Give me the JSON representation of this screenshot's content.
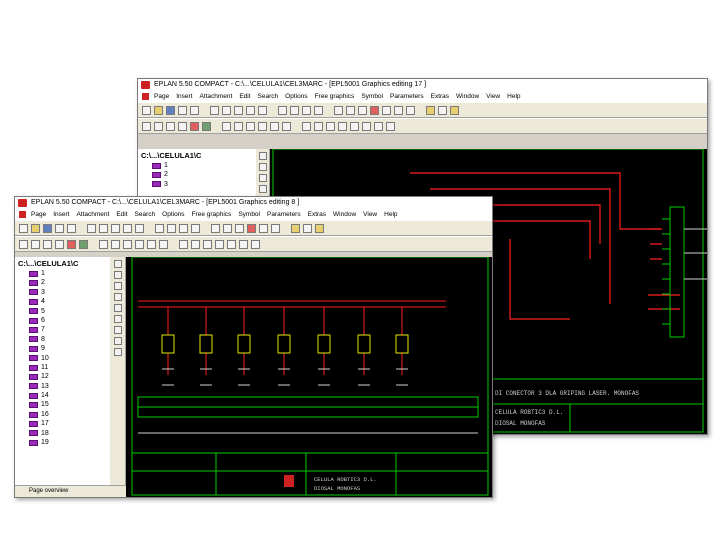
{
  "back_window": {
    "title": "EPLAN 5.50 COMPACT - C:\\...\\CELULA1\\CEL3MARC - [EPL5001 Graphics editing 17 ]",
    "menu": [
      "Page",
      "Insert",
      "Attachment",
      "Edit",
      "Search",
      "Options",
      "Free graphics",
      "Symbol",
      "Parameters",
      "Extras",
      "Window",
      "View",
      "Help"
    ],
    "tree_root": "C:\\...\\CELULA1\\C",
    "tree_items": [
      "1",
      "2",
      "3"
    ],
    "titleblock": {
      "title": "DI CONECTOR 3 DLA GRIPING   LASER. MONOFAS",
      "company": "CELULA ROBTIC3 D.L.",
      "drawing": "DIOSAL MONOFAS"
    }
  },
  "front_window": {
    "title": "EPLAN 5.50 COMPACT - C:\\...\\CELULA1\\CEL3MARC - [EPL5001 Graphics editing 8 ]",
    "menu": [
      "Page",
      "Insert",
      "Attachment",
      "Edit",
      "Search",
      "Options",
      "Free graphics",
      "Symbol",
      "Parameters",
      "Extras",
      "Window",
      "View",
      "Help"
    ],
    "tree_root": "C:\\...\\CELULA1\\C",
    "tree_items": [
      "1",
      "2",
      "3",
      "4",
      "5",
      "6",
      "7",
      "8",
      "9",
      "10",
      "11",
      "12",
      "13",
      "14",
      "15",
      "16",
      "17",
      "18",
      "19"
    ],
    "status": "Page overview",
    "company": "CELULA ROBTIC3 D.L.",
    "drawing": "DIOSAL MONOFAS"
  },
  "colors": {
    "wire": "#ff2020",
    "cad_green": "#00cc00",
    "cad_text": "#cfcfcf",
    "relay": "#e8e800",
    "page_icon": "#9a2ab8"
  }
}
